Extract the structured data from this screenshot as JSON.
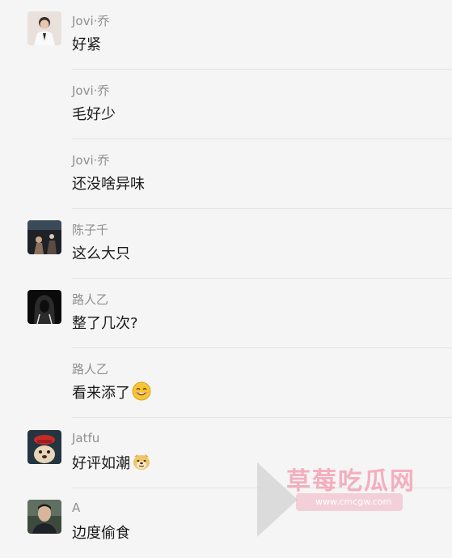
{
  "comments": [
    {
      "name": "Jovi·乔",
      "text": "好紧",
      "avatar": "avatar-man-white-suit"
    },
    {
      "name": "Jovi·乔",
      "text": "毛好少",
      "avatar": null
    },
    {
      "name": "Jovi·乔",
      "text": "还没啥异味",
      "avatar": null
    },
    {
      "name": "陈子千",
      "text": "这么大只",
      "avatar": "avatar-dark-stage-photo"
    },
    {
      "name": "路人乙",
      "text": "整了几次?",
      "avatar": "avatar-hooded-figure"
    },
    {
      "name": "路人乙",
      "text": "看来添了",
      "emoji": "smiling-face-emoji",
      "avatar": null
    },
    {
      "name": "Jatfu",
      "text": "好评如潮",
      "emoji": "doge-emoji",
      "avatar": "avatar-dog-with-hat"
    },
    {
      "name": "A",
      "text": "边度偷食",
      "avatar": "avatar-man-portrait"
    }
  ],
  "watermark": {
    "logo_text": "草莓吃瓜网",
    "url_text": "www.cmcgw.com",
    "icon": "play-triangle-icon"
  },
  "colors": {
    "background": "#f5f5f5",
    "name": "#8f8f8f",
    "text": "#1a1a1a",
    "divider": "#e4e4e4",
    "watermark_text": "#f2a0b2"
  }
}
